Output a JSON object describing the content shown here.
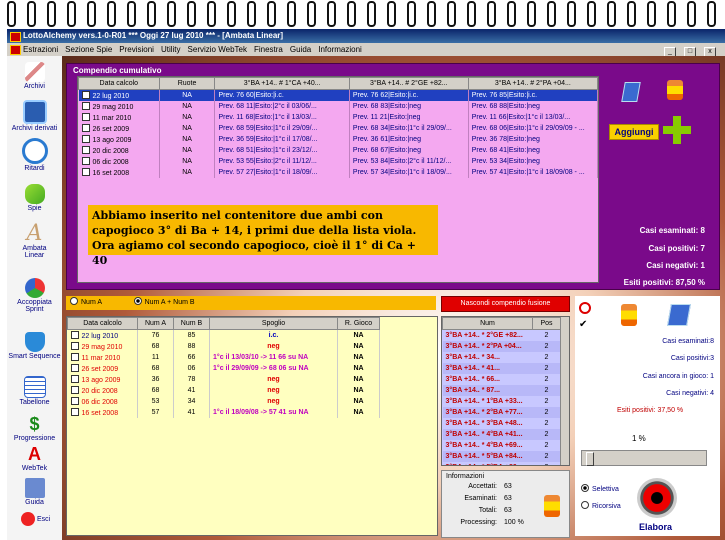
{
  "window": {
    "title": "LottoAlchemy vers.1-0-R01  ***  Oggi 27 lug 2010  ***  - [Ambata Linear]",
    "controls": [
      "_",
      "□",
      "x"
    ]
  },
  "menu": [
    "Estrazioni",
    "Sezione Spie",
    "Previsioni",
    "Utility",
    "Servizio WebTek",
    "Finestra",
    "Guida",
    "Informazioni"
  ],
  "sidebar": [
    {
      "label": "Archivi",
      "icon": "pencil-icon"
    },
    {
      "label": "Archivi derivati",
      "icon": "book-icon"
    },
    {
      "label": "Ritardi",
      "icon": "clock-icon"
    },
    {
      "label": "Spie",
      "icon": "flashlight-icon"
    },
    {
      "label": "Ambata Linear",
      "icon": "letter-a-icon"
    },
    {
      "label": "Accoppiata Sprint",
      "icon": "recycle-icon"
    },
    {
      "label": "Smart Sequence",
      "icon": "shield-icon"
    },
    {
      "label": "Tabellone",
      "icon": "calendar-icon"
    },
    {
      "label": "Progressione",
      "icon": "dollar-icon"
    },
    {
      "label": "WebTek",
      "icon": "webtek-icon"
    },
    {
      "label": "Guida",
      "icon": "help-book-icon"
    },
    {
      "label": "Esci",
      "icon": "exit-icon"
    }
  ],
  "compendio": {
    "label": "Compendio cumulativo",
    "headers": [
      "Data calcolo",
      "Ruote",
      "3°BA +14.. # 1°CA +40...",
      "3°BA +14.. # 2°GE +82...",
      "3°BA +14.. # 2°PA +04..."
    ],
    "rows": [
      {
        "date": "22 lug 2010",
        "ruote": "NA",
        "c1": "Prev. 76 60|Esito:|i.c.",
        "c2": "Prev. 76 62|Esito:|i.c.",
        "c3": "Prev. 76 85|Esito:|i.c."
      },
      {
        "date": "29 mag 2010",
        "ruote": "NA",
        "c1": "Prev. 68 11|Esito:|2°c il 03/06/...",
        "c2": "Prev. 68 83|Esito:|neg",
        "c3": "Prev. 68 88|Esito:|neg"
      },
      {
        "date": "11 mar 2010",
        "ruote": "NA",
        "c1": "Prev. 11 68|Esito:|1°c il 13/03/...",
        "c2": "Prev. 11 21|Esito:|neg",
        "c3": "Prev. 11 66|Esito:|1°c il 13/03/..."
      },
      {
        "date": "26 set 2009",
        "ruote": "NA",
        "c1": "Prev. 68 59|Esito:|1°c il 29/09/...",
        "c2": "Prev. 68 34|Esito:|1°c il 29/09/...",
        "c3": "Prev. 68 06|Esito:|1°c il 29/09/09 - ..."
      },
      {
        "date": "13 ago 2009",
        "ruote": "NA",
        "c1": "Prev. 36 59|Esito:|1°c il 17/08/...",
        "c2": "Prev. 36 61|Esito:|neg",
        "c3": "Prev. 36 78|Esito:|neg"
      },
      {
        "date": "20 dic 2008",
        "ruote": "NA",
        "c1": "Prev. 68 51|Esito:|1°c il 23/12/...",
        "c2": "Prev. 68 67|Esito:|neg",
        "c3": "Prev. 68 41|Esito:|neg"
      },
      {
        "date": "06 dic 2008",
        "ruote": "NA",
        "c1": "Prev. 53 55|Esito:|2°c il 11/12/...",
        "c2": "Prev. 53 84|Esito:|2°c il 11/12/...",
        "c3": "Prev. 53 34|Esito:|neg"
      },
      {
        "date": "16 set 2008",
        "ruote": "NA",
        "c1": "Prev. 57 27|Esito:|1°c il 18/09/...",
        "c2": "Prev. 57 34|Esito:|1°c il 18/09/...",
        "c3": "Prev. 57 41|Esito:|1°c il 18/09/08 - ..."
      }
    ],
    "note": "Abbiamo inserito nel contenitore due ambi con capogioco 3° di Ba + 14, i primi due della lista viola. Ora agiamo col secondo capogioco, cioè il 1° di Ca + 40",
    "add_label": "Aggiungi",
    "stats": [
      {
        "label": "Casi esaminati: 8"
      },
      {
        "label": "Casi positivi: 7"
      },
      {
        "label": "Casi negativi: 1"
      },
      {
        "label": "Esiti positivi: 87,50 %"
      }
    ]
  },
  "modes": {
    "num_a": "Num A",
    "num_ab": "Num A + Num B",
    "selected": "Num A + Num B"
  },
  "spoglio": {
    "headers": [
      "Data calcolo",
      "Num A",
      "Num B",
      "Spoglio",
      "R. Gioco"
    ],
    "rows": [
      {
        "date": "22 lug 2010",
        "a": "76",
        "b": "85",
        "spoglio": "i.c.",
        "gioco": "NA",
        "kind": "ic"
      },
      {
        "date": "29 mag 2010",
        "a": "68",
        "b": "88",
        "spoglio": "neg",
        "gioco": "NA",
        "kind": "neg"
      },
      {
        "date": "11 mar 2010",
        "a": "11",
        "b": "66",
        "spoglio": "1°c il 13/03/10 -> 11 66 su NA",
        "gioco": "NA",
        "kind": "pos"
      },
      {
        "date": "26 set 2009",
        "a": "68",
        "b": "06",
        "spoglio": "1°c il 29/09/09 -> 68 06 su NA",
        "gioco": "NA",
        "kind": "pos"
      },
      {
        "date": "13 ago 2009",
        "a": "36",
        "b": "78",
        "spoglio": "neg",
        "gioco": "NA",
        "kind": "neg"
      },
      {
        "date": "20 dic 2008",
        "a": "68",
        "b": "41",
        "spoglio": "neg",
        "gioco": "NA",
        "kind": "neg"
      },
      {
        "date": "06 dic 2008",
        "a": "53",
        "b": "34",
        "spoglio": "neg",
        "gioco": "NA",
        "kind": "neg"
      },
      {
        "date": "16 set 2008",
        "a": "57",
        "b": "41",
        "spoglio": "1°c il 18/09/08 -> 57 41 su NA",
        "gioco": "NA",
        "kind": "pos"
      }
    ]
  },
  "hide_button": "Nascondi compendio fusione",
  "numlist": {
    "headers": [
      "Num",
      "Pos"
    ],
    "rows": [
      {
        "num": "3°BA +14.. * 2°GE +82...",
        "pos": "2"
      },
      {
        "num": "3°BA +14.. * 2°PA +04...",
        "pos": "2"
      },
      {
        "num": "3°BA +14.. * 34...",
        "pos": "2"
      },
      {
        "num": "3°BA +14.. * 41...",
        "pos": "2"
      },
      {
        "num": "3°BA +14.. * 66...",
        "pos": "2"
      },
      {
        "num": "3°BA +14.. * 87...",
        "pos": "2"
      },
      {
        "num": "3°BA +14.. * 1°BA +33...",
        "pos": "2"
      },
      {
        "num": "3°BA +14.. * 2°BA +77...",
        "pos": "2"
      },
      {
        "num": "3°BA +14.. * 3°BA +48...",
        "pos": "2"
      },
      {
        "num": "3°BA +14.. * 4°BA +41...",
        "pos": "2"
      },
      {
        "num": "3°BA +14.. * 4°BA +69...",
        "pos": "2"
      },
      {
        "num": "3°BA +14.. * 5°BA +84...",
        "pos": "2"
      },
      {
        "num": "3°BA +14.. * 5°BA +89...",
        "pos": "2"
      }
    ]
  },
  "info": {
    "title": "Informazioni",
    "rows": [
      {
        "k": "Accettati:",
        "v": "63"
      },
      {
        "k": "Esaminati:",
        "v": "63"
      },
      {
        "k": "Totali:",
        "v": "63"
      },
      {
        "k": "Processing:",
        "v": "100 %"
      }
    ]
  },
  "right": {
    "lines": [
      "Casi esaminati:8",
      "Casi positivi:3",
      "Casi ancora in gioco: 1",
      "Casi negativi: 4",
      "Esiti positivi: 37,50 %"
    ],
    "percent": "1 %",
    "slider_level": 0.02,
    "opt_selettiva": "Selettiva",
    "opt_ricorsiva": "Ricorsiva",
    "selected": "Selettiva",
    "elabora": "Elabora"
  }
}
